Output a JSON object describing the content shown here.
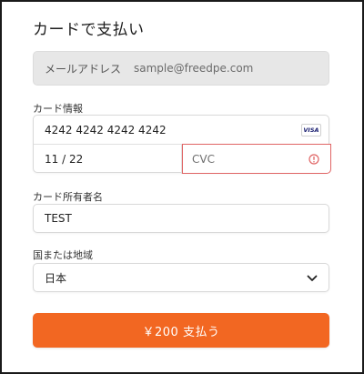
{
  "title": "カードで支払い",
  "email": {
    "label": "メールアドレス",
    "value": "sample@freedpe.com"
  },
  "card": {
    "label": "カード情報",
    "number": "4242 4242 4242 4242",
    "brand": "VISA",
    "expiry": "11 / 22",
    "cvc_placeholder": "CVC"
  },
  "cardholder": {
    "label": "カード所有者名",
    "value": "TEST"
  },
  "country": {
    "label": "国または地域",
    "selected": "日本"
  },
  "pay_button": {
    "label": "￥200 支払う"
  },
  "colors": {
    "accent": "#f26722",
    "error": "#e06464"
  },
  "icons": {
    "card_brand": "visa-icon",
    "cvc_state": "error-icon",
    "country_select": "chevron-down-icon"
  }
}
